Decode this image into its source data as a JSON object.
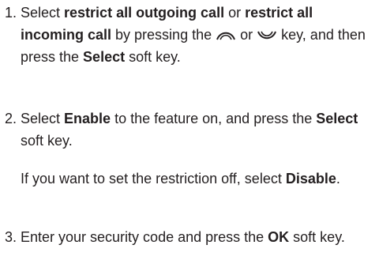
{
  "steps": [
    {
      "number": "1.",
      "t1": "Select ",
      "b1": "restrict all outgoing call",
      "t2": " or ",
      "b2": "restrict all incoming call",
      "t3": " by pressing the ",
      "up_key_icon": "up-navigation-key-icon",
      "t4": " or ",
      "down_key_icon": "down-navigation-key-icon",
      "t5": " key, and then press the ",
      "b3": "Select",
      "t6": " soft key."
    },
    {
      "number": "2.",
      "t1": "Select ",
      "b1": "Enable",
      "t2": " to the feature on, and press the ",
      "b2": "Select",
      "t3": " soft key.",
      "note_text": "If you want to set the restriction off, select ",
      "note_bold": "Disable",
      "note_end": "."
    },
    {
      "number": "3.",
      "t1": "Enter your security code and press the ",
      "b1": "OK",
      "t2": " soft key."
    }
  ]
}
